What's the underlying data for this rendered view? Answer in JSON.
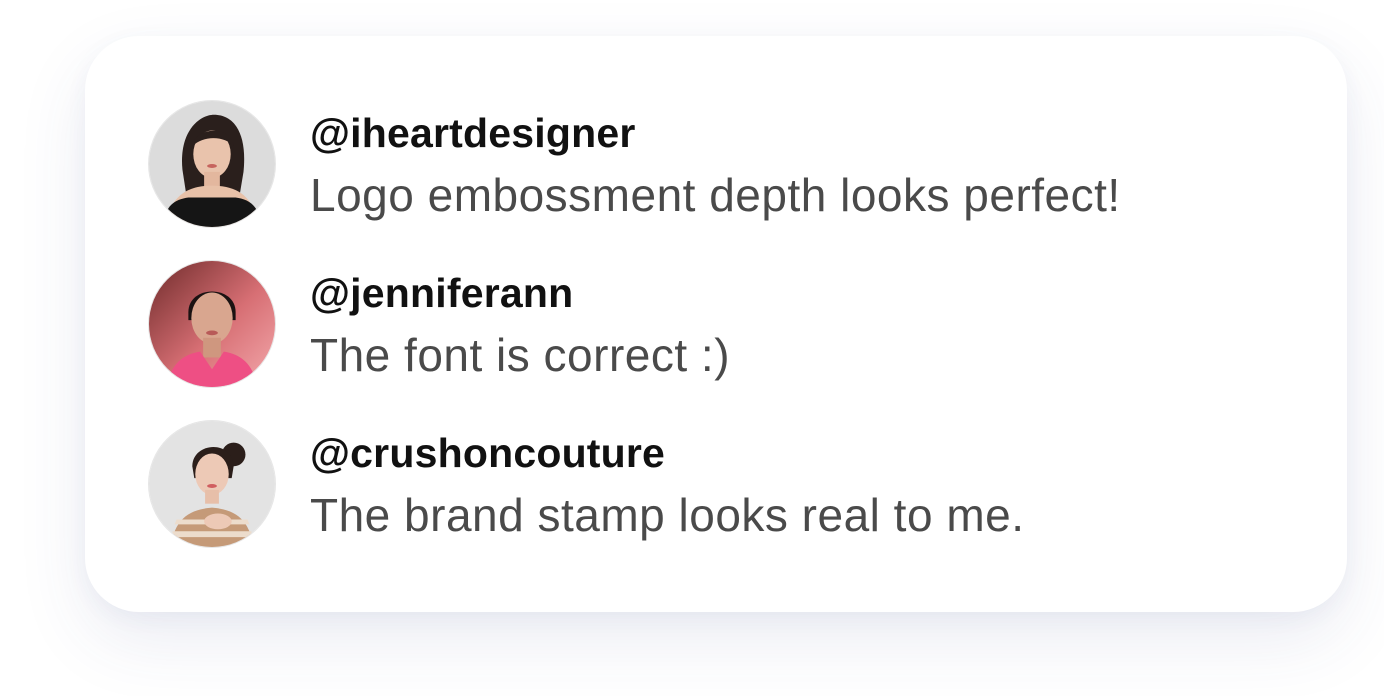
{
  "comments": [
    {
      "username": "@iheartdesigner",
      "message": "Logo embossment depth looks perfect!",
      "avatar_icon": "user-avatar-photo"
    },
    {
      "username": "@jenniferann",
      "message": "The font is correct :)",
      "avatar_icon": "user-avatar-photo"
    },
    {
      "username": "@crushoncouture",
      "message": "The brand stamp looks real to me.",
      "avatar_icon": "user-avatar-photo"
    }
  ],
  "colors": {
    "card_background": "#ffffff",
    "username": "#111111",
    "message": "#4a4a4a"
  }
}
